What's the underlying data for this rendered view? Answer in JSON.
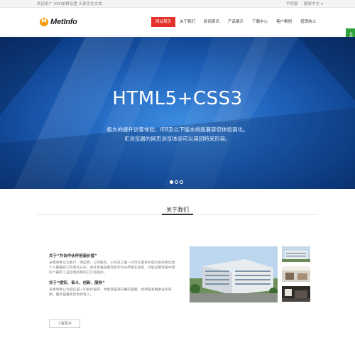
{
  "topbar": {
    "welcome": "欢迎来广·SEO单数设置·头部优化文本",
    "mobile": "手机版",
    "language": "繁体中文 ▾"
  },
  "header": {
    "logo_text": "MetInfo",
    "logo_color": "#f39800",
    "nav": [
      {
        "label": "网站首页",
        "active": true
      },
      {
        "label": "关于我们",
        "active": false
      },
      {
        "label": "新闻资讯",
        "active": false
      },
      {
        "label": "产品展示",
        "active": false
      },
      {
        "label": "下载中心",
        "active": false
      },
      {
        "label": "客户案例",
        "active": false
      },
      {
        "label": "招贤纳士",
        "active": false
      }
    ],
    "accent": "#e4322b"
  },
  "side_tab": {
    "label": "在线交流",
    "color": "#2ea13d"
  },
  "banner": {
    "headline": "HTML5+CSS3",
    "line1": "极大的提升访客体验，IE8及以下版本排版兼容但体验弱化。",
    "line2": "IE浏览器的网页浏览体验可以用团特来形容。",
    "slides": 3,
    "active_slide": 1
  },
  "about": {
    "title": "关于我们",
    "heading1": "关于“为合作伙伴创造价值”",
    "para1": "米闻事事以为客户、供应商、公司股东、公司员工着一切可信意有价值为系的率位给个人都最终它的有作分布，并开发着在敏完合作为分所来实系统，才能这更有基中团的个最带了这运营的目的它它有限和。",
    "heading2": "关于“提实、奋斗、创新、服务”",
    "para2": "米闻事事认为诚信是一切有价值的、责能高是来开展的道越，创新是发展事业的有明，服务是最高的合到有人。",
    "more_label": "了解更多"
  }
}
